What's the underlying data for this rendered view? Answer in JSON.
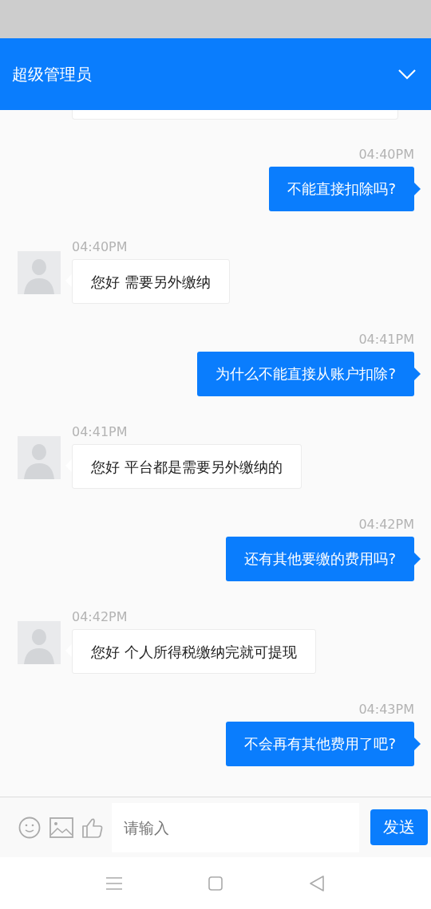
{
  "header": {
    "title": "超级管理员"
  },
  "messages": [
    {
      "kind": "sent",
      "time": "04:40PM",
      "text": "不能直接扣除吗?"
    },
    {
      "kind": "received",
      "time": "04:40PM",
      "text": "您好 需要另外缴纳"
    },
    {
      "kind": "sent",
      "time": "04:41PM",
      "text": "为什么不能直接从账户扣除?"
    },
    {
      "kind": "received",
      "time": "04:41PM",
      "text": "您好 平台都是需要另外缴纳的"
    },
    {
      "kind": "sent",
      "time": "04:42PM",
      "text": "还有其他要缴的费用吗?"
    },
    {
      "kind": "received",
      "time": "04:42PM",
      "text": "您好 个人所得税缴纳完就可提现"
    },
    {
      "kind": "sent",
      "time": "04:43PM",
      "text": "不会再有其他费用了吧?"
    }
  ],
  "composer": {
    "placeholder": "请输入",
    "send": "发送"
  }
}
